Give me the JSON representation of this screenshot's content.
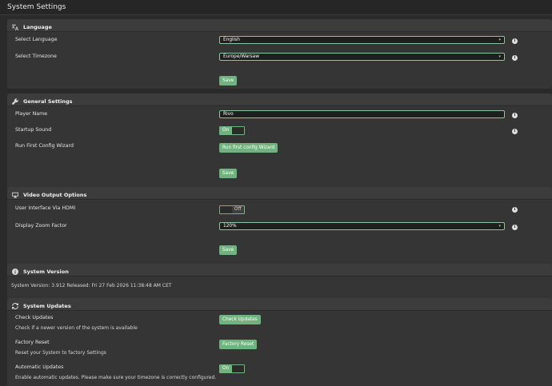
{
  "page_title": "System Settings",
  "language": {
    "title": "Language",
    "select_language_label": "Select Language",
    "language_value": "English",
    "select_timezone_label": "Select Timezone",
    "timezone_value": "Europe/Warsaw",
    "save_label": "Save"
  },
  "general": {
    "title": "General Settings",
    "player_name_label": "Player Name",
    "player_name_value": "Rivo",
    "startup_sound_label": "Startup Sound",
    "startup_sound_state": "On",
    "first_config_label": "Run First Config Wizard",
    "first_config_button": "Run first config Wizard",
    "save_label": "Save"
  },
  "video": {
    "title": "Video Output Options",
    "ui_hdmi_label": "User Interface Via HDMI",
    "ui_hdmi_state": "Off",
    "zoom_label": "Display Zoom Factor",
    "zoom_value": "120%",
    "save_label": "Save"
  },
  "version": {
    "title": "System Version",
    "text": "System Version: 3.912 Released: Fri 27 Feb 2026 11:38:48 AM CET"
  },
  "updates": {
    "title": "System Updates",
    "check_label": "Check Updates",
    "check_desc": "Check if a newer version of the system is available",
    "check_button": "Check Updates",
    "reset_label": "Factory Reset",
    "reset_desc": "Reset your System to factory Settings",
    "reset_button": "Factory Reset",
    "auto_label": "Automatic Updates",
    "auto_desc": "Enable automatic updates. Please make sure your timezone is correctly configured.",
    "auto_state": "On"
  },
  "icons": {
    "info": "i"
  },
  "colors": {
    "accent": "#6fb47f",
    "panel": "#353535",
    "panel_header": "#3c3c3c",
    "background": "#2a2a2a"
  }
}
